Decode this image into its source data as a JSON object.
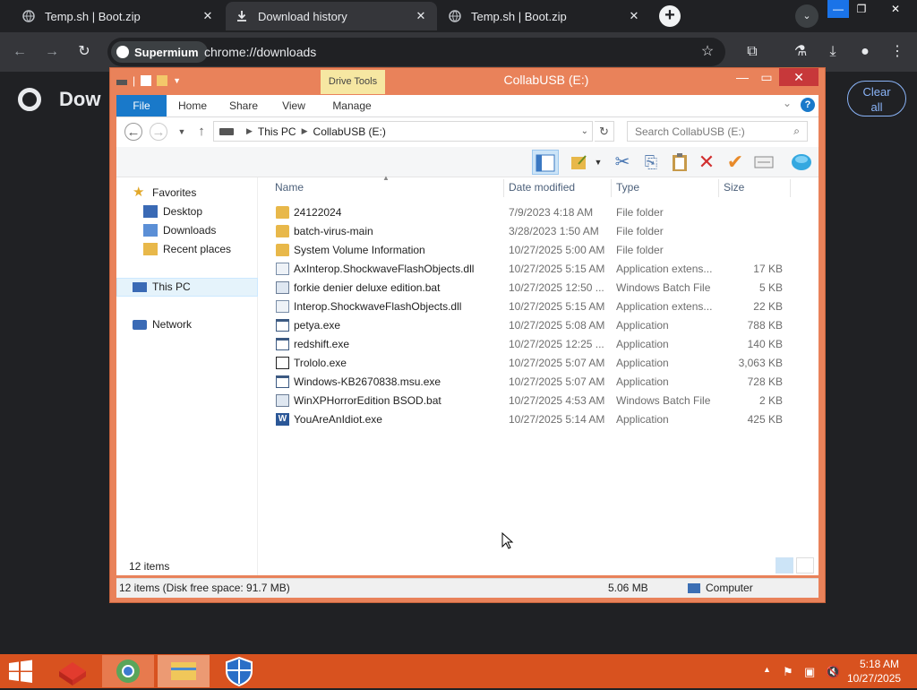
{
  "browser": {
    "tabs": [
      {
        "title": "Temp.sh | Boot.zip",
        "active": false
      },
      {
        "title": "Download history",
        "active": true
      },
      {
        "title": "Temp.sh | Boot.zip",
        "active": false
      }
    ],
    "new_tab_icon": "plus-icon",
    "chip_label": "Supermium",
    "url": "chrome://downloads",
    "page_heading": "Dow",
    "clear_all_line1": "Clear",
    "clear_all_line2": "all"
  },
  "explorer": {
    "title": "CollabUSB (E:)",
    "contextual_tab": "Drive Tools",
    "ribbon_tabs": [
      "File",
      "Home",
      "Share",
      "View",
      "Manage"
    ],
    "breadcrumb": [
      "This PC",
      "CollabUSB (E:)"
    ],
    "search_placeholder": "Search CollabUSB (E:)",
    "columns": {
      "name": "Name",
      "date": "Date modified",
      "type": "Type",
      "size": "Size"
    },
    "nav": {
      "favorites": "Favorites",
      "desktop": "Desktop",
      "downloads": "Downloads",
      "recent": "Recent places",
      "thispc": "This PC",
      "network": "Network"
    },
    "files": [
      {
        "name": "24122024",
        "date": "7/9/2023 4:18 AM",
        "type": "File folder",
        "size": "",
        "icon": "folder"
      },
      {
        "name": "batch-virus-main",
        "date": "3/28/2023 1:50 AM",
        "type": "File folder",
        "size": "",
        "icon": "folder"
      },
      {
        "name": "System Volume Information",
        "date": "10/27/2025 5:00 AM",
        "type": "File folder",
        "size": "",
        "icon": "folder"
      },
      {
        "name": "AxInterop.ShockwaveFlashObjects.dll",
        "date": "10/27/2025 5:15 AM",
        "type": "Application extens...",
        "size": "17 KB",
        "icon": "dll"
      },
      {
        "name": "forkie denier deluxe edition.bat",
        "date": "10/27/2025 12:50 ...",
        "type": "Windows Batch File",
        "size": "5 KB",
        "icon": "bat"
      },
      {
        "name": "Interop.ShockwaveFlashObjects.dll",
        "date": "10/27/2025 5:15 AM",
        "type": "Application extens...",
        "size": "22 KB",
        "icon": "dll"
      },
      {
        "name": "petya.exe",
        "date": "10/27/2025 5:08 AM",
        "type": "Application",
        "size": "788 KB",
        "icon": "app"
      },
      {
        "name": "redshift.exe",
        "date": "10/27/2025 12:25 ...",
        "type": "Application",
        "size": "140 KB",
        "icon": "app"
      },
      {
        "name": "Trololo.exe",
        "date": "10/27/2025 5:07 AM",
        "type": "Application",
        "size": "3,063 KB",
        "icon": "exe2"
      },
      {
        "name": "Windows-KB2670838.msu.exe",
        "date": "10/27/2025 5:07 AM",
        "type": "Application",
        "size": "728 KB",
        "icon": "app"
      },
      {
        "name": "WinXPHorrorEdition BSOD.bat",
        "date": "10/27/2025 4:53 AM",
        "type": "Windows Batch File",
        "size": "2 KB",
        "icon": "bat"
      },
      {
        "name": "YouAreAnIdiot.exe",
        "date": "10/27/2025 5:14 AM",
        "type": "Application",
        "size": "425 KB",
        "icon": "word"
      }
    ],
    "item_count": "12 items",
    "details_text": "12 items (Disk free space: 91.7 MB)",
    "details_size": "5.06 MB",
    "details_location": "Computer"
  },
  "taskbar": {
    "time": "5:18 AM",
    "date": "10/27/2025",
    "accent": "#d8521f"
  }
}
